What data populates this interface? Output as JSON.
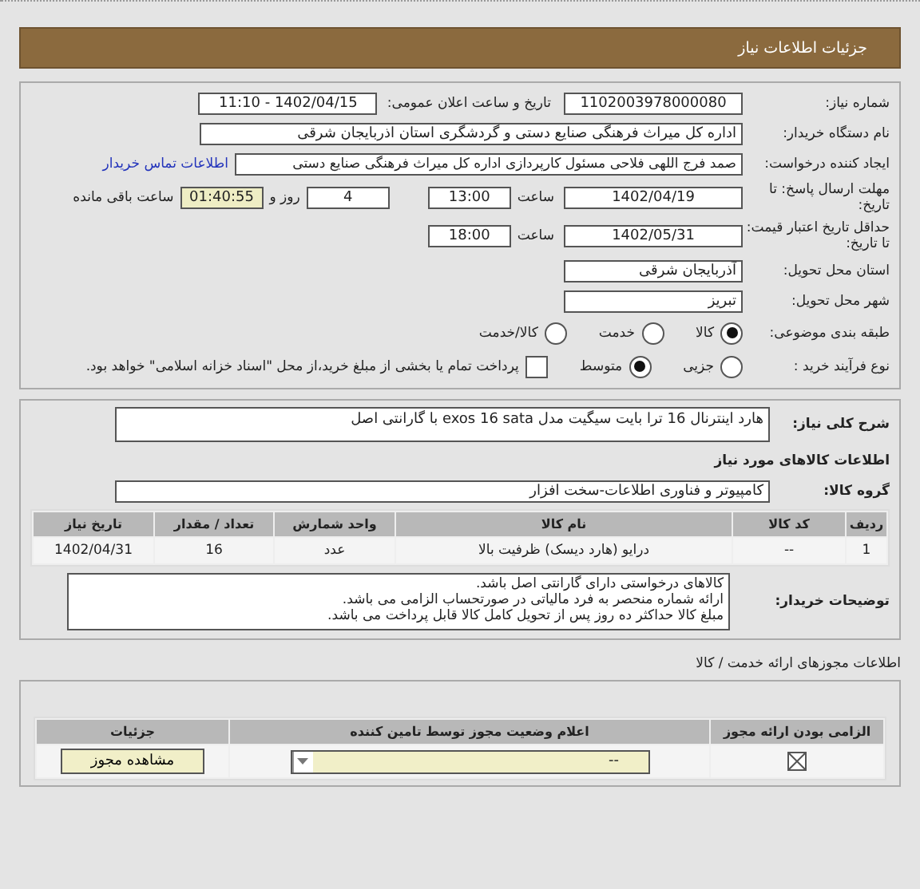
{
  "header": {
    "title": "جزئیات اطلاعات نیاز"
  },
  "need": {
    "number_label": "شماره نیاز:",
    "number": "1102003978000080",
    "announce_label": "تاریخ و ساعت اعلان عمومی:",
    "announce": "1402/04/15 - 11:10",
    "buyer_label": "نام دستگاه خریدار:",
    "buyer": "اداره کل میراث فرهنگی  صنایع دستی و گردشگری استان اذربایجان شرقی",
    "creator_label": "ایجاد کننده درخواست:",
    "creator": "صمد فرج اللهی فلاحی مسئول کارپردازی اداره کل میراث فرهنگی  صنایع دستی",
    "contact_link": "اطلاعات تماس خریدار",
    "deadline_label": "مهلت ارسال پاسخ: تا تاریخ:",
    "deadline_date": "1402/04/19",
    "deadline_time_label": "ساعت",
    "deadline_time": "13:00",
    "days": "4",
    "days_label": "روز و",
    "remaining": "01:40:55",
    "remaining_label": "ساعت باقی مانده",
    "validity_label": "حداقل تاریخ اعتبار قیمت: تا تاریخ:",
    "validity_date": "1402/05/31",
    "validity_time_label": "ساعت",
    "validity_time": "18:00",
    "province_label": "استان محل تحویل:",
    "province": "آذربایجان شرقی",
    "city_label": "شهر محل تحویل:",
    "city": "تبریز",
    "category_label": "طبقه بندی موضوعی:",
    "categories": [
      {
        "label": "کالا",
        "selected": true
      },
      {
        "label": "خدمت",
        "selected": false
      },
      {
        "label": "کالا/خدمت",
        "selected": false
      }
    ],
    "process_label": "نوع فرآیند خرید :",
    "processes": [
      {
        "label": "جزیی",
        "selected": false
      },
      {
        "label": "متوسط",
        "selected": true
      }
    ],
    "treasury": {
      "checked": false,
      "label": "پرداخت تمام یا بخشی از مبلغ خرید،از محل \"اسناد خزانه اسلامی\" خواهد بود."
    }
  },
  "goods": {
    "summary_label": "شرح کلی نیاز:",
    "summary": "هارد اینترنال 16 ترا بایت سیگیت مدل exos 16 sata با گارانتی اصل",
    "section_title": "اطلاعات کالاهای مورد نیاز",
    "group_label": "گروه کالا:",
    "group": "کامپیوتر و فناوری اطلاعات-سخت افزار",
    "columns": [
      "ردیف",
      "کد کالا",
      "نام کالا",
      "واحد شمارش",
      "تعداد / مقدار",
      "تاریخ نیاز"
    ],
    "rows": [
      [
        "1",
        "--",
        "درایو (هارد دیسک) ظرفیت بالا",
        "عدد",
        "16",
        "1402/04/31"
      ]
    ],
    "notes_label": "توضیحات خریدار:",
    "notes": [
      "کالاهای درخواستی دارای گارانتی اصل باشد.",
      "ارائه شماره منحصر به فرد مالیاتی در صورتحساب الزامی می باشد.",
      "مبلغ کالا حداکثر ده روز پس از تحویل کامل کالا قابل پرداخت می باشد."
    ]
  },
  "permits": {
    "title": "اطلاعات مجوزهای ارائه خدمت / کالا",
    "columns": [
      "الزامی بودن ارائه مجوز",
      "اعلام وضعیت مجوز توسط تامین کننده",
      "جزئیات"
    ],
    "rows": [
      {
        "required": true,
        "status": "--",
        "button": "مشاهده مجوز"
      }
    ]
  }
}
